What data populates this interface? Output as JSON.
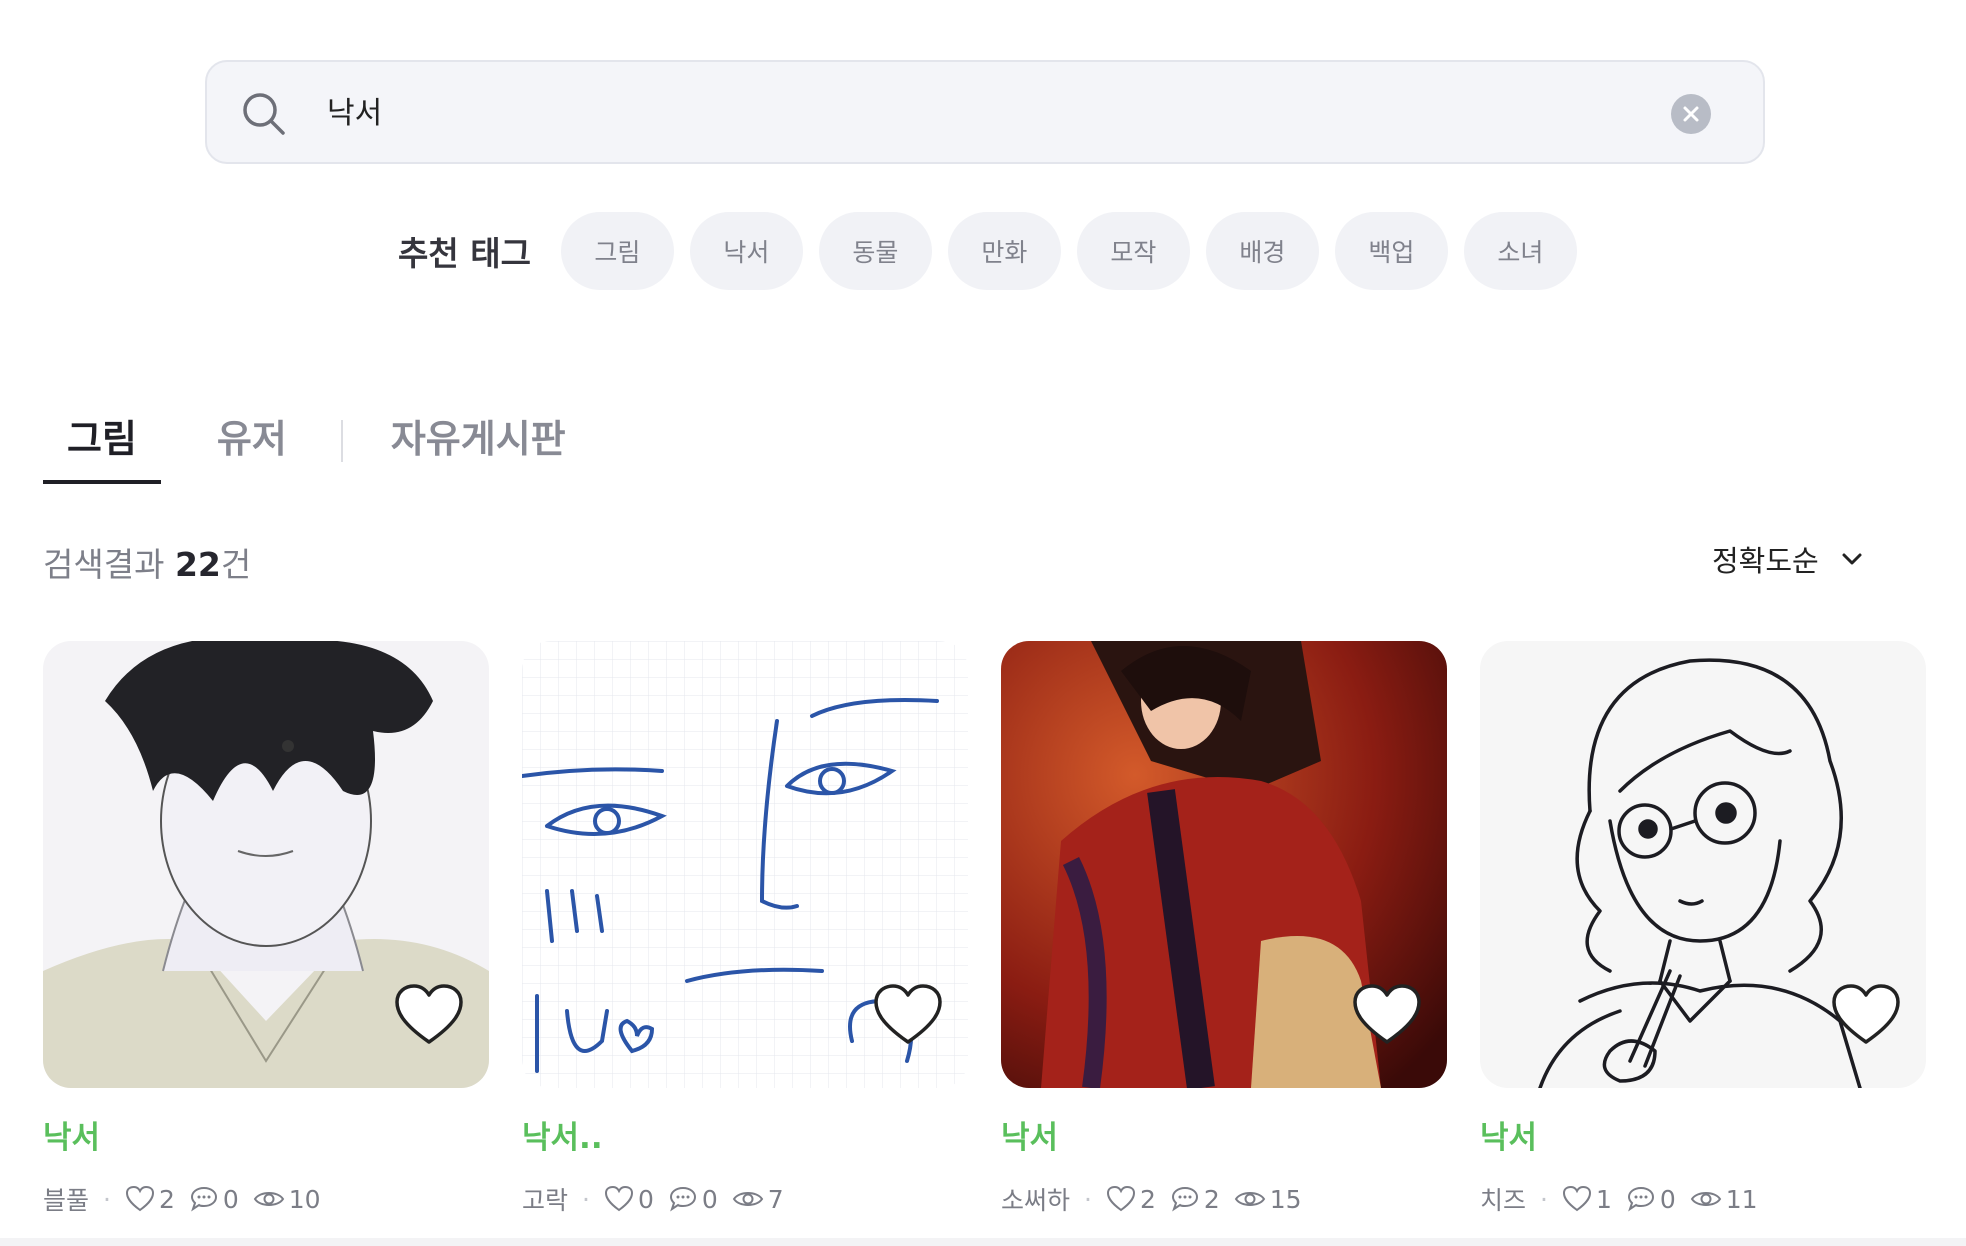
{
  "search": {
    "query": "낙서"
  },
  "tags": {
    "title": "추천 태그",
    "items": [
      "그림",
      "낙서",
      "동물",
      "만화",
      "모작",
      "배경",
      "백업",
      "소녀"
    ]
  },
  "tabs": [
    {
      "label": "그림",
      "active": true
    },
    {
      "label": "유저",
      "active": false
    },
    {
      "label": "자유게시판",
      "active": false
    }
  ],
  "results": {
    "prefix": "검색결과 ",
    "count": "22",
    "suffix": "건"
  },
  "sort": {
    "label": "정확도순"
  },
  "cards": [
    {
      "title": "낙서",
      "author": "블풀",
      "likes": "2",
      "comments": "0",
      "views": "10"
    },
    {
      "title": "낙서..",
      "author": "고락",
      "likes": "0",
      "comments": "0",
      "views": "7"
    },
    {
      "title": "낙서",
      "author": "소써하",
      "likes": "2",
      "comments": "2",
      "views": "15"
    },
    {
      "title": "낙서",
      "author": "치즈",
      "likes": "1",
      "comments": "0",
      "views": "11"
    }
  ],
  "colors": {
    "accent_green": "#5abf5c",
    "chip_bg": "#f1f2f6",
    "search_bg": "#f4f5f9"
  }
}
